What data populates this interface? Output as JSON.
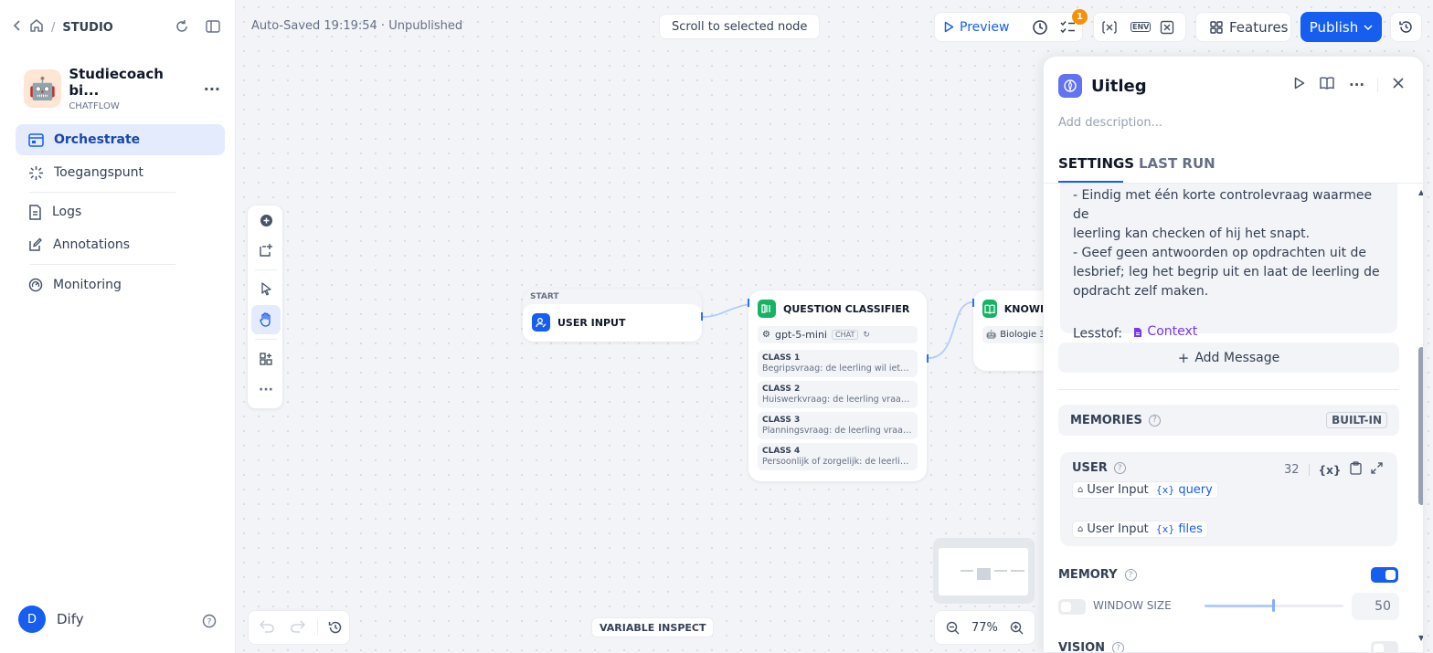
{
  "sidebar": {
    "breadcrumb": "STUDIO",
    "app_name": "Studiecoach bi...",
    "app_type": "CHATFLOW",
    "nav": [
      {
        "label": "Orchestrate"
      },
      {
        "label": "Toegangspunt"
      },
      {
        "label": "Logs"
      },
      {
        "label": "Annotations"
      },
      {
        "label": "Monitoring"
      }
    ],
    "user_initial": "D",
    "user_name": "Dify"
  },
  "topbar": {
    "autosave": "Auto-Saved 19:19:54 · Unpublished",
    "scroll_to_selected": "Scroll to selected node",
    "preview": "Preview",
    "checklist_count": "1",
    "env_label": "ENV",
    "features": "Features",
    "publish": "Publish"
  },
  "nodes": {
    "start_label": "START",
    "user_input": "USER INPUT",
    "classifier_title": "QUESTION CLASSIFIER",
    "model": "gpt-5-mini",
    "model_mode": "CHAT",
    "classes": [
      {
        "title": "CLASS 1",
        "desc": "Begripsvraag: de leerling wil iets u..."
      },
      {
        "title": "CLASS 2",
        "desc": "Huiswerkvraag: de leerling vraagt ..."
      },
      {
        "title": "CLASS 3",
        "desc": "Planningsvraag: de leerling vraagt..."
      },
      {
        "title": "CLASS 4",
        "desc": "Persoonlijk of zorgelijk: de leerling..."
      }
    ],
    "knowledge_title": "KNOWL",
    "knowledge_item": "Biologie 3"
  },
  "canvas_footer": {
    "variable_inspect": "VARIABLE INSPECT",
    "zoom": "77%"
  },
  "panel": {
    "title": "Uitleg",
    "description_placeholder": "Add description...",
    "tabs": [
      {
        "label": "SETTINGS"
      },
      {
        "label": "LAST RUN"
      }
    ],
    "prompt_lines": [
      "- Eindig met één korte controlevraag waarmee de",
      "leerling kan checken of hij het snapt.",
      "- Geef geen antwoorden op opdrachten uit de",
      "lesbrief; leg het begrip uit en laat de leerling de",
      "opdracht zelf maken."
    ],
    "context_label": "Lesstof:",
    "context_value": "Context",
    "add_message": "Add Message",
    "memories_label": "MEMORIES",
    "builtin_label": "BUILT-IN",
    "user_label": "USER",
    "user_token_count": "32",
    "var_chips": [
      {
        "source": "User Input",
        "var": "query"
      },
      {
        "source": "User Input",
        "var": "files"
      }
    ],
    "memory_label": "MEMORY",
    "memory_enabled": true,
    "window_size_label": "WINDOW SIZE",
    "window_size_value": "50",
    "vision_label": "VISION"
  },
  "colors": {
    "accent": "#155eef",
    "nav_active_bg": "#e4ebfd",
    "classifier_icon": "#16b364",
    "context_purple": "#7839ee",
    "badge": "#f79009"
  }
}
